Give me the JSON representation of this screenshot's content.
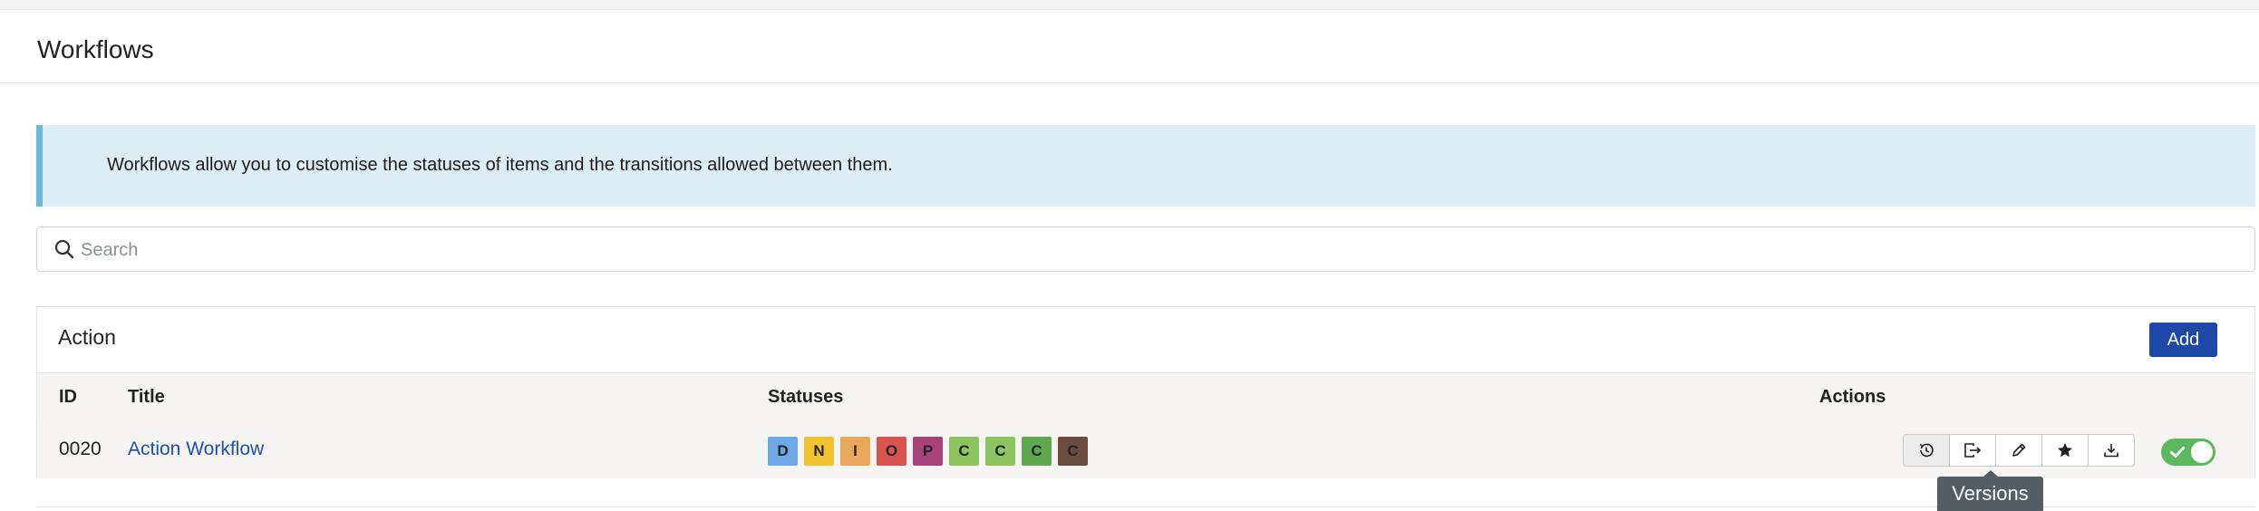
{
  "page": {
    "title": "Workflows"
  },
  "info": {
    "text": "Workflows allow you to customise the statuses of items and the transitions allowed between them."
  },
  "search": {
    "placeholder": "Search",
    "value": ""
  },
  "section": {
    "title": "Action",
    "add_label": "Add",
    "columns": {
      "id": "ID",
      "title": "Title",
      "statuses": "Statuses",
      "actions": "Actions"
    },
    "rows": [
      {
        "id": "0020",
        "title": "Action Workflow",
        "statuses": [
          {
            "letter": "D",
            "color": "#6fa8e6"
          },
          {
            "letter": "N",
            "color": "#f2c230"
          },
          {
            "letter": "I",
            "color": "#e9a75a"
          },
          {
            "letter": "O",
            "color": "#d9534f"
          },
          {
            "letter": "P",
            "color": "#a9427a"
          },
          {
            "letter": "C",
            "color": "#8cc45f"
          },
          {
            "letter": "C",
            "color": "#8cc45f"
          },
          {
            "letter": "C",
            "color": "#5fa84f"
          },
          {
            "letter": "C",
            "color": "#6b4c3e"
          }
        ],
        "actions": [
          "history-icon",
          "export-icon",
          "pencil-icon",
          "star-icon",
          "download-icon"
        ],
        "enabled": true
      }
    ]
  },
  "tooltip": {
    "text": "Versions"
  }
}
